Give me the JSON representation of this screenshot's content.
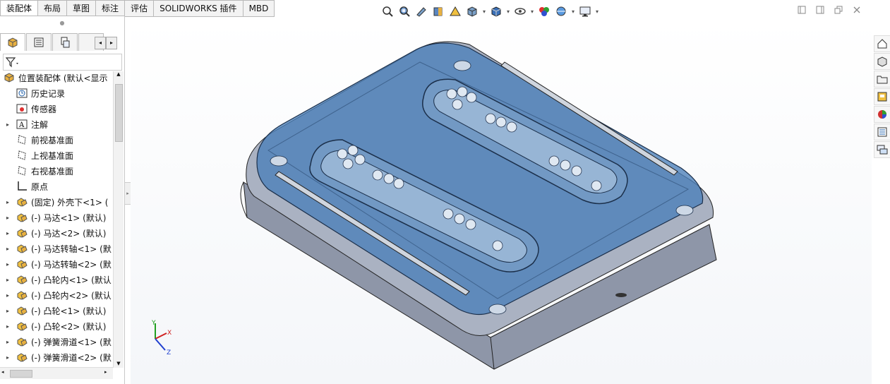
{
  "command_tabs": [
    {
      "label": "装配体",
      "active": true
    },
    {
      "label": "布局",
      "active": false
    },
    {
      "label": "草图",
      "active": false
    },
    {
      "label": "标注",
      "active": false
    },
    {
      "label": "评估",
      "active": false
    },
    {
      "label": "SOLIDWORKS 插件",
      "active": false
    },
    {
      "label": "MBD",
      "active": false
    }
  ],
  "toolbar_icons": [
    "zoom-to-fit-icon",
    "zoom-to-area-icon",
    "previous-view-icon",
    "section-view-icon",
    "dynamic-annotation-icon",
    "view-orientation-icon",
    "display-style-icon",
    "hide-show-items-icon",
    "edit-appearance-icon",
    "apply-scene-icon",
    "view-settings-icon"
  ],
  "feature_tree": {
    "root": "位置装配体  (默认<显示",
    "items": [
      {
        "label": "历史记录",
        "icon": "history-icon",
        "expander": false
      },
      {
        "label": "传感器",
        "icon": "sensor-icon",
        "expander": false
      },
      {
        "label": "注解",
        "icon": "annotation-icon",
        "expander": true
      },
      {
        "label": "前视基准面",
        "icon": "plane-icon",
        "expander": false
      },
      {
        "label": "上视基准面",
        "icon": "plane-icon",
        "expander": false
      },
      {
        "label": "右视基准面",
        "icon": "plane-icon",
        "expander": false
      },
      {
        "label": "原点",
        "icon": "origin-icon",
        "expander": false
      },
      {
        "label": "(固定) 外壳下<1> (",
        "icon": "part-icon",
        "expander": true
      },
      {
        "label": "(-) 马达<1> (默认)",
        "icon": "part-icon",
        "expander": true
      },
      {
        "label": "(-) 马达<2> (默认)",
        "icon": "part-icon",
        "expander": true
      },
      {
        "label": "(-) 马达转轴<1> (默",
        "icon": "part-icon",
        "expander": true
      },
      {
        "label": "(-) 马达转轴<2> (默",
        "icon": "part-icon",
        "expander": true
      },
      {
        "label": "(-) 凸轮内<1> (默认",
        "icon": "part-icon",
        "expander": true
      },
      {
        "label": "(-) 凸轮内<2> (默认",
        "icon": "part-icon",
        "expander": true
      },
      {
        "label": "(-) 凸轮<1> (默认)",
        "icon": "part-icon",
        "expander": true
      },
      {
        "label": "(-) 凸轮<2> (默认)",
        "icon": "part-icon",
        "expander": true
      },
      {
        "label": "(-) 弹簧滑道<1> (默",
        "icon": "part-icon",
        "expander": true
      },
      {
        "label": "(-) 弹簧滑道<2> (默",
        "icon": "part-icon",
        "expander": true
      }
    ]
  },
  "triad": {
    "x": "X",
    "y": "Y",
    "z": "Z"
  },
  "task_pane_icons": [
    "home-icon",
    "design-library-icon",
    "file-explorer-icon",
    "view-palette-icon",
    "appearances-icon",
    "custom-properties-icon",
    "forum-icon"
  ],
  "colors": {
    "accent": "#1f5fa8",
    "glass": "#4a7fb8",
    "body": "#8c95a8"
  }
}
